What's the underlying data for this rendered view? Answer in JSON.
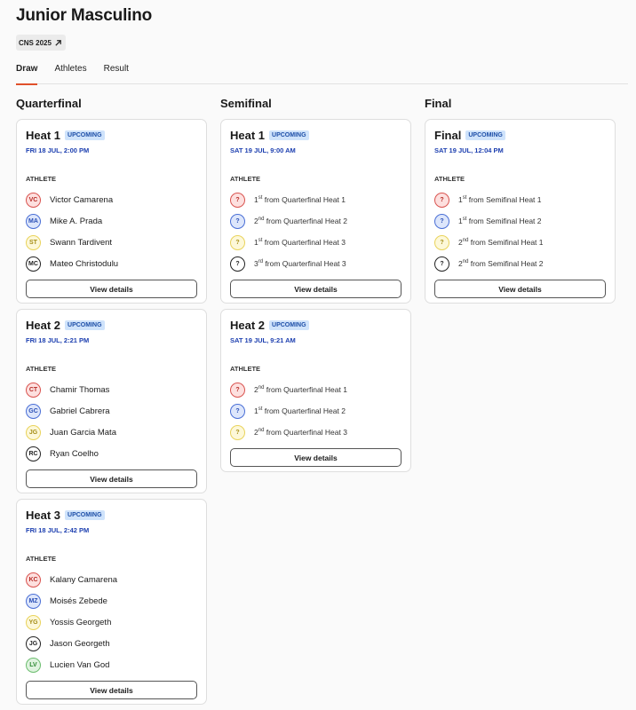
{
  "page": {
    "title": "Junior Masculino",
    "event_badge": "CNS 2025"
  },
  "tabs": [
    {
      "label": "Draw"
    },
    {
      "label": "Athletes"
    },
    {
      "label": "Result"
    }
  ],
  "columns": [
    {
      "title": "Quarterfinal",
      "heats": [
        {
          "name": "Heat 1",
          "status": "UPCOMING",
          "date": "FRI 18 JUL, 2:00 PM",
          "athlete_label": "ATHLETE",
          "athletes": [
            {
              "initials": "VC",
              "name": "Victor Camarena",
              "color": "red"
            },
            {
              "initials": "MA",
              "name": "Mike A. Prada",
              "color": "blue"
            },
            {
              "initials": "ST",
              "name": "Swann Tardivent",
              "color": "yellow"
            },
            {
              "initials": "MC",
              "name": "Mateo Christodulu",
              "color": "dark"
            }
          ],
          "button": "View details"
        },
        {
          "name": "Heat 2",
          "status": "UPCOMING",
          "date": "FRI 18 JUL, 2:21 PM",
          "athlete_label": "ATHLETE",
          "athletes": [
            {
              "initials": "CT",
              "name": "Chamir Thomas",
              "color": "red"
            },
            {
              "initials": "GC",
              "name": "Gabriel Cabrera",
              "color": "blue"
            },
            {
              "initials": "JG",
              "name": "Juan Garcia Mata",
              "color": "yellow"
            },
            {
              "initials": "RC",
              "name": "Ryan Coelho",
              "color": "dark"
            }
          ],
          "button": "View details"
        },
        {
          "name": "Heat 3",
          "status": "UPCOMING",
          "date": "FRI 18 JUL, 2:42 PM",
          "athlete_label": "ATHLETE",
          "athletes": [
            {
              "initials": "KC",
              "name": "Kalany Camarena",
              "color": "red"
            },
            {
              "initials": "MZ",
              "name": "Moisés Zebede",
              "color": "blue"
            },
            {
              "initials": "YG",
              "name": "Yossis Georgeth",
              "color": "yellow"
            },
            {
              "initials": "JG",
              "name": "Jason Georgeth",
              "color": "dark"
            },
            {
              "initials": "LV",
              "name": "Lucien Van God",
              "color": "green"
            }
          ],
          "button": "View details"
        }
      ]
    },
    {
      "title": "Semifinal",
      "heats": [
        {
          "name": "Heat 1",
          "status": "UPCOMING",
          "date": "SAT 19 JUL, 9:00 AM",
          "athlete_label": "ATHLETE",
          "athletes": [
            {
              "initials": "?",
              "rank": "1",
              "suffix": "st",
              "source": " from Quarterfinal Heat 1",
              "color": "red"
            },
            {
              "initials": "?",
              "rank": "2",
              "suffix": "nd",
              "source": " from Quarterfinal Heat 2",
              "color": "blue"
            },
            {
              "initials": "?",
              "rank": "1",
              "suffix": "st",
              "source": " from Quarterfinal Heat 3",
              "color": "yellow"
            },
            {
              "initials": "?",
              "rank": "3",
              "suffix": "rd",
              "source": " from Quarterfinal Heat 3",
              "color": "dark"
            }
          ],
          "button": "View details"
        },
        {
          "name": "Heat 2",
          "status": "UPCOMING",
          "date": "SAT 19 JUL, 9:21 AM",
          "athlete_label": "ATHLETE",
          "athletes": [
            {
              "initials": "?",
              "rank": "2",
              "suffix": "nd",
              "source": " from Quarterfinal Heat 1",
              "color": "red"
            },
            {
              "initials": "?",
              "rank": "1",
              "suffix": "st",
              "source": " from Quarterfinal Heat 2",
              "color": "blue"
            },
            {
              "initials": "?",
              "rank": "2",
              "suffix": "nd",
              "source": " from Quarterfinal Heat 3",
              "color": "yellow"
            }
          ],
          "button": "View details"
        }
      ]
    },
    {
      "title": "Final",
      "heats": [
        {
          "name": "Final",
          "status": "UPCOMING",
          "date": "SAT 19 JUL, 12:04 PM",
          "athlete_label": "ATHLETE",
          "athletes": [
            {
              "initials": "?",
              "rank": "1",
              "suffix": "st",
              "source": " from Semifinal Heat 1",
              "color": "red"
            },
            {
              "initials": "?",
              "rank": "1",
              "suffix": "st",
              "source": " from Semifinal Heat 2",
              "color": "blue"
            },
            {
              "initials": "?",
              "rank": "2",
              "suffix": "nd",
              "source": " from Semifinal Heat 1",
              "color": "yellow"
            },
            {
              "initials": "?",
              "rank": "2",
              "suffix": "nd",
              "source": " from Semifinal Heat 2",
              "color": "dark"
            }
          ],
          "button": "View details"
        }
      ]
    }
  ],
  "theme": {
    "accent": "#e0502a",
    "status_bg": "#cfe3fb",
    "status_text": "#1e4fa8",
    "date_text": "#1e40b0",
    "lane_colors": {
      "red": "#d9534f",
      "blue": "#4a6fd6",
      "yellow": "#e9d35b",
      "dark": "#222222",
      "green": "#6bbd6e"
    }
  },
  "icons": {
    "event_badge": "arrow-up-right-icon"
  }
}
